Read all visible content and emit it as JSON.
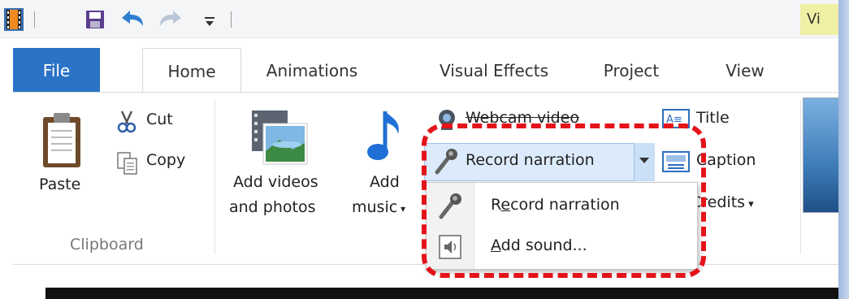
{
  "window": {
    "title_partial": "Vi"
  },
  "quick_access": {
    "items": [
      {
        "name": "app-icon"
      },
      {
        "name": "save-icon"
      },
      {
        "name": "undo-icon"
      },
      {
        "name": "redo-icon"
      },
      {
        "name": "customize-qat-icon"
      }
    ]
  },
  "tabs": [
    {
      "label": "File"
    },
    {
      "label": "Home"
    },
    {
      "label": "Animations"
    },
    {
      "label": "Visual Effects"
    },
    {
      "label": "Project"
    },
    {
      "label": "View"
    }
  ],
  "ribbon": {
    "clipboard": {
      "paste": "Paste",
      "cut": "Cut",
      "copy": "Copy",
      "group_label": "Clipboard"
    },
    "add": {
      "add_videos_line1": "Add videos",
      "add_videos_line2": "and photos",
      "add_music_line1": "Add",
      "add_music_line2": "music",
      "webcam": "Webcam video",
      "record_narration": "Record narration",
      "title": "Title",
      "caption": "Caption",
      "credits": "Credits"
    }
  },
  "dropdown": {
    "items": [
      {
        "label_pre": "R",
        "label_u": "e",
        "label_post": "cord narration",
        "icon": "microphone-icon"
      },
      {
        "label_pre": "",
        "label_u": "A",
        "label_post": "dd sound...",
        "icon": "speaker-icon"
      }
    ]
  },
  "colors": {
    "file_tab": "#2b73c7",
    "highlight": "#e4131a",
    "title_chip": "#f0f0a4"
  }
}
